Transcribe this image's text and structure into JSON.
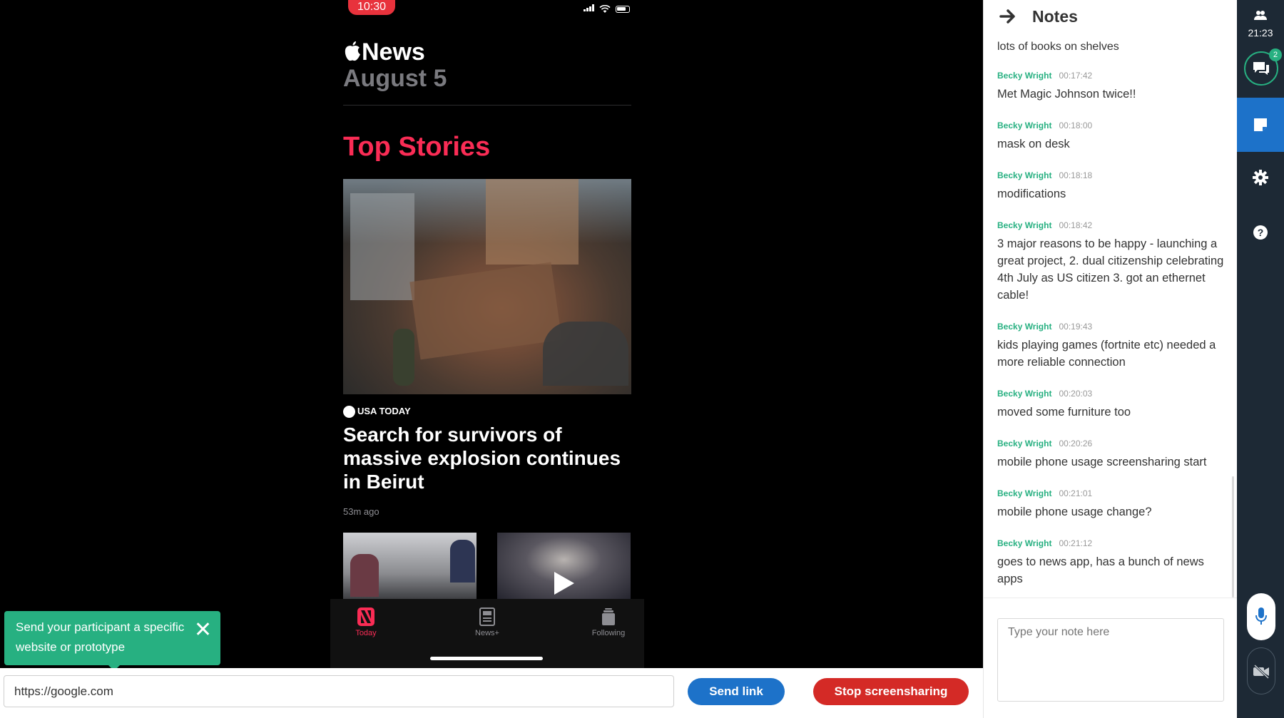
{
  "phone": {
    "status_time": "10:30",
    "app_brand": "News",
    "date": "August 5",
    "section_title": "Top Stories",
    "story": {
      "source": "USA TODAY",
      "headline": "Search for survivors of massive explosion continues in Beirut",
      "age": "53m ago"
    },
    "tabs": [
      {
        "label": "Today"
      },
      {
        "label": "News+"
      },
      {
        "label": "Following"
      }
    ]
  },
  "tooltip": {
    "text": "Send your participant a specific website or prototype"
  },
  "bottombar": {
    "url_value": "https://google.com",
    "send_label": "Send link",
    "stop_label": "Stop screensharing"
  },
  "notes": {
    "title": "Notes",
    "first_partial": "lots of books on shelves",
    "items": [
      {
        "author": "Becky Wright",
        "time": "00:17:42",
        "text": "Met Magic Johnson twice!!"
      },
      {
        "author": "Becky Wright",
        "time": "00:18:00",
        "text": "mask on desk"
      },
      {
        "author": "Becky Wright",
        "time": "00:18:18",
        "text": "modifications"
      },
      {
        "author": "Becky Wright",
        "time": "00:18:42",
        "text": "3 major reasons to be happy - launching a great project, 2. dual citizenship celebrating 4th July as US citizen 3. got an ethernet cable!"
      },
      {
        "author": "Becky Wright",
        "time": "00:19:43",
        "text": "kids playing games (fortnite etc) needed a more reliable connection"
      },
      {
        "author": "Becky Wright",
        "time": "00:20:03",
        "text": "moved some furniture too"
      },
      {
        "author": "Becky Wright",
        "time": "00:20:26",
        "text": "mobile phone usage screensharing start"
      },
      {
        "author": "Becky Wright",
        "time": "00:21:01",
        "text": "mobile phone usage change?"
      },
      {
        "author": "Becky Wright",
        "time": "00:21:12",
        "text": "goes to news app, has a bunch of news apps"
      }
    ],
    "input_placeholder": "Type your note here"
  },
  "rail": {
    "session_time": "21:23",
    "chat_badge": "2",
    "help_glyph": "?"
  },
  "colors": {
    "accent_green": "#27b081",
    "primary_blue": "#1d72c9",
    "danger_red": "#d42a26",
    "news_pink": "#fa2c55",
    "rail_bg": "#1d2935"
  }
}
